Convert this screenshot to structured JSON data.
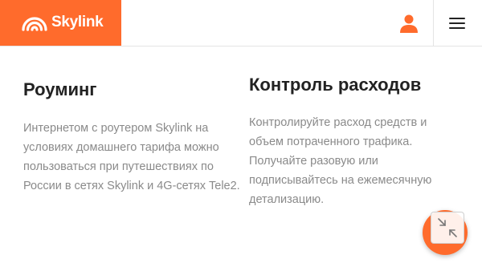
{
  "header": {
    "logo_text": "Skylink",
    "brand_color": "#ff6b2c",
    "user_icon": "user-icon",
    "menu_icon": "hamburger-menu-icon"
  },
  "features": [
    {
      "title": "Роуминг",
      "description": "Интернетом с роутером Skylink на условиях домашнего тарифа можно пользоваться при путешествиях по России в сетях Skylink и 4G-сетях Tele2."
    },
    {
      "title": "Контроль расходов",
      "description": "Контролируйте расход средств и объем потраченного трафика. Получайте разовую или подписывайтесь на ежемесячную детализацию."
    }
  ],
  "fab": {
    "icon": "collapse-arrows-icon"
  }
}
